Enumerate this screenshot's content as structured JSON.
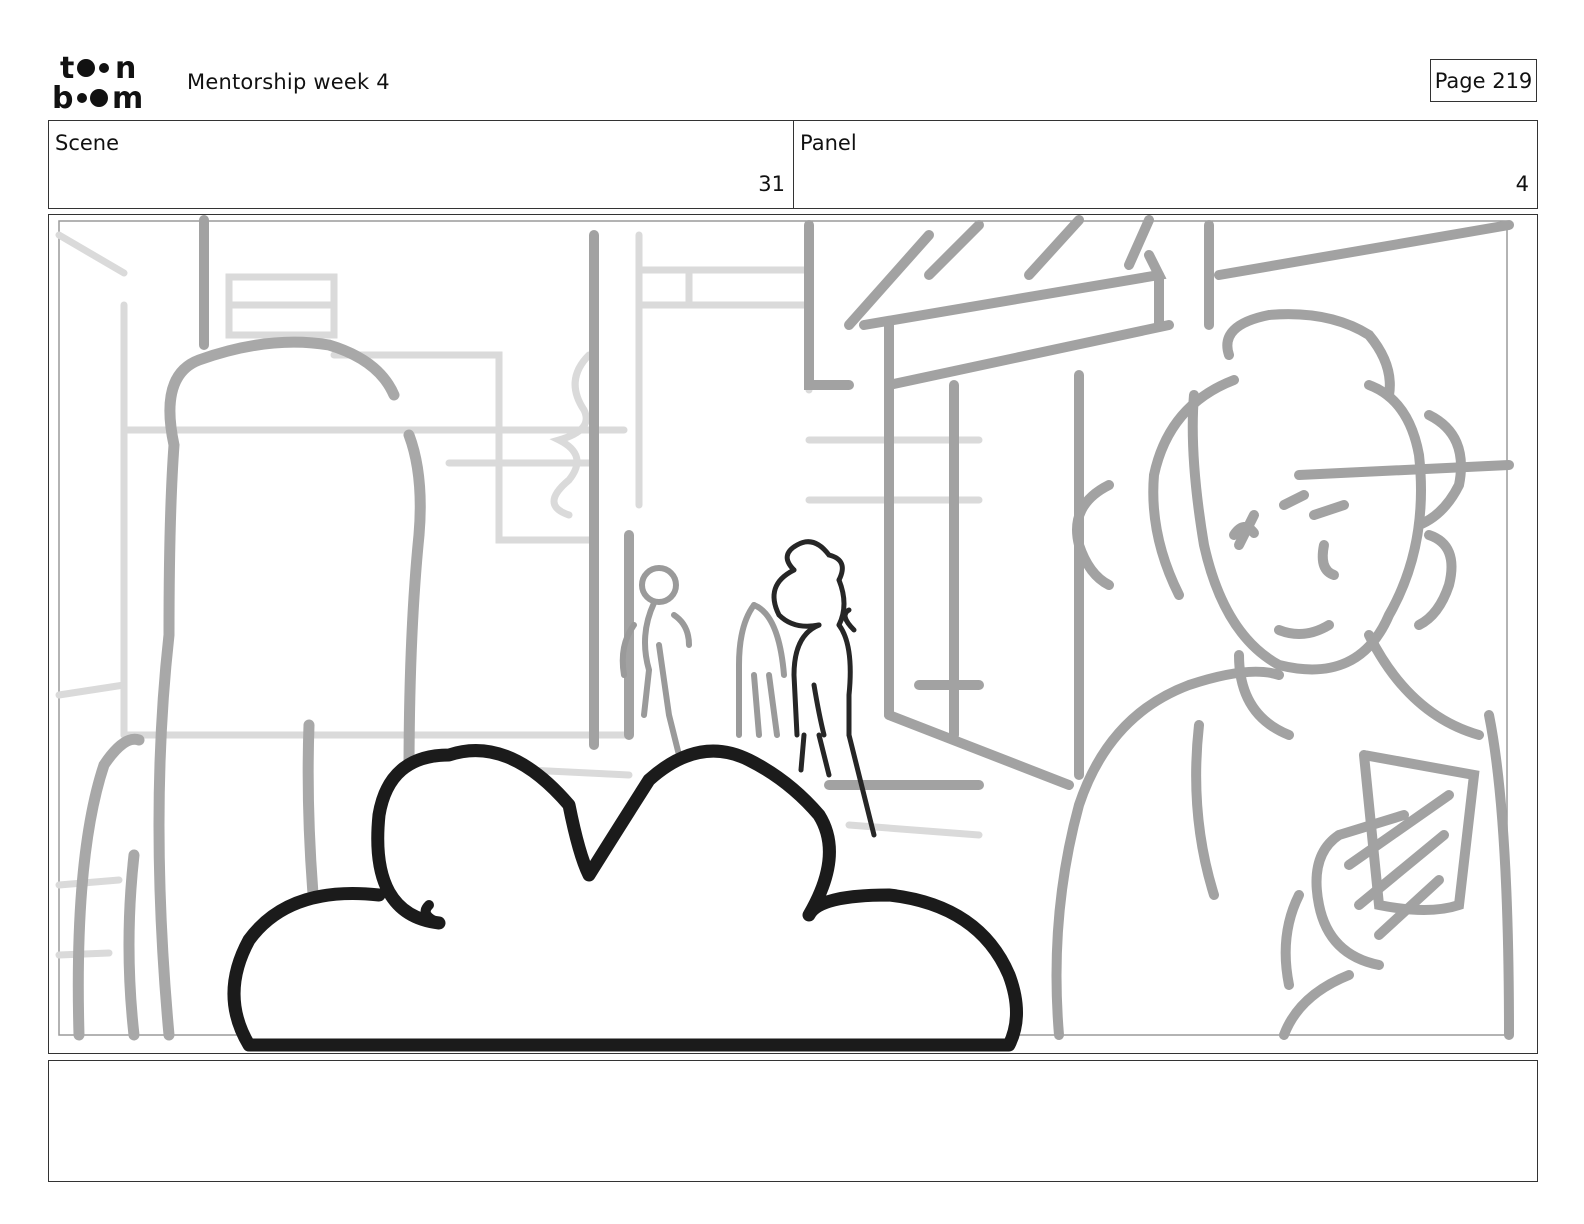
{
  "header": {
    "logo_text": "toon boom",
    "title": "Mentorship week 4",
    "page_label": "Page 219"
  },
  "info": {
    "scene_label": "Scene",
    "scene_value": "31",
    "panel_label": "Panel",
    "panel_value": "4"
  },
  "drawing": {
    "description_icon": "storyboard-sketch",
    "colors": {
      "background_lines": "#d9d9d9",
      "midground_lines": "#9a9a9a",
      "foreground_lines": "#1e1e1e"
    }
  },
  "notes": {
    "text": ""
  }
}
